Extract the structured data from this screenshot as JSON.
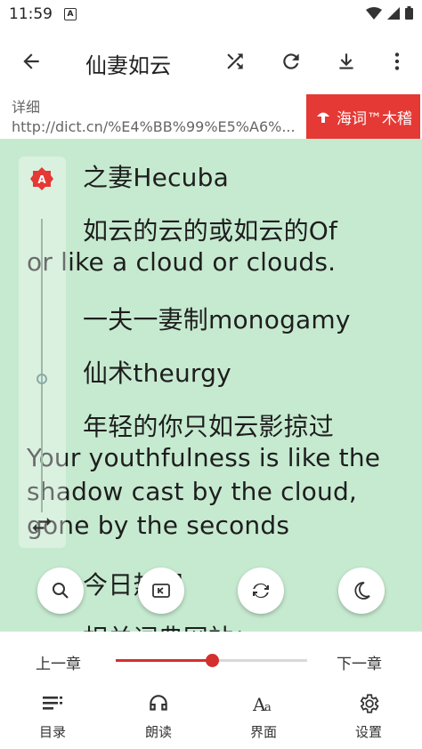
{
  "status_bar": {
    "time": "11:59",
    "notification": "A"
  },
  "toolbar": {
    "title": "仙妻如云"
  },
  "source": {
    "label": "详细",
    "url": "http://dict.cn/%E4%BB%99%E5%A6%...",
    "badge_text": "海词™木稽"
  },
  "reader": {
    "lines": [
      "之妻Hecuba",
      "如云的云的或如云的Of",
      "or like a cloud or clouds.",
      "一夫一妻制monogamy",
      "仙术theurgy",
      "年轻的你只如云影掠过",
      "Your youthfulness is like the",
      "shadow cast by the cloud,",
      "gone by the seconds",
      "今日热词",
      "相关词典网站："
    ],
    "side_slider_badge": "A"
  },
  "chapter_nav": {
    "prev_label": "上一章",
    "next_label": "下一章",
    "progress": 0.5
  },
  "bottom_nav": {
    "items": [
      {
        "label": "目录",
        "icon": "toc-list-icon"
      },
      {
        "label": "朗读",
        "icon": "headphones-icon"
      },
      {
        "label": "界面",
        "icon": "font-style-icon"
      },
      {
        "label": "设置",
        "icon": "gear-icon"
      }
    ]
  },
  "colors": {
    "reader_background": "#c6ead0",
    "accent": "#d32f2f",
    "badge": "#e53935"
  }
}
